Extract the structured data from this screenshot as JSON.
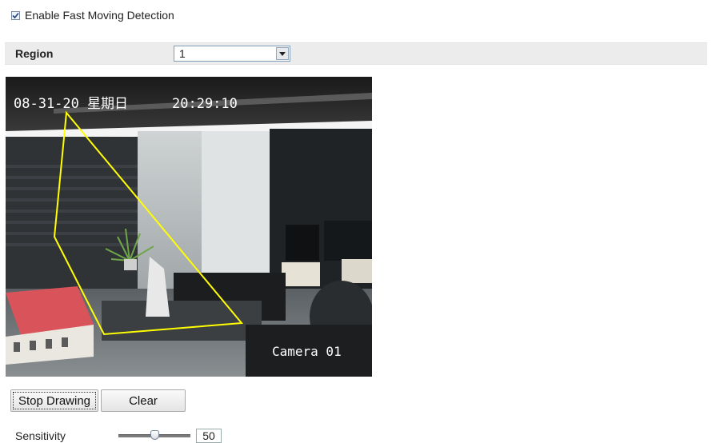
{
  "detection": {
    "enable_label": "Enable Fast Moving Detection",
    "enabled": true
  },
  "region": {
    "label": "Region",
    "selected": "1"
  },
  "video": {
    "timestamp": "08-31-20",
    "timestamp_cn": "星期日",
    "time": "20:29:10",
    "camera_label": "Camera 01"
  },
  "buttons": {
    "stop_drawing": "Stop Drawing",
    "clear": "Clear"
  },
  "sensitivity": {
    "label": "Sensitivity",
    "value": "50",
    "level": 0.5
  },
  "colors": {
    "region_polygon": "#ffff00",
    "bar_background": "#ececec"
  }
}
